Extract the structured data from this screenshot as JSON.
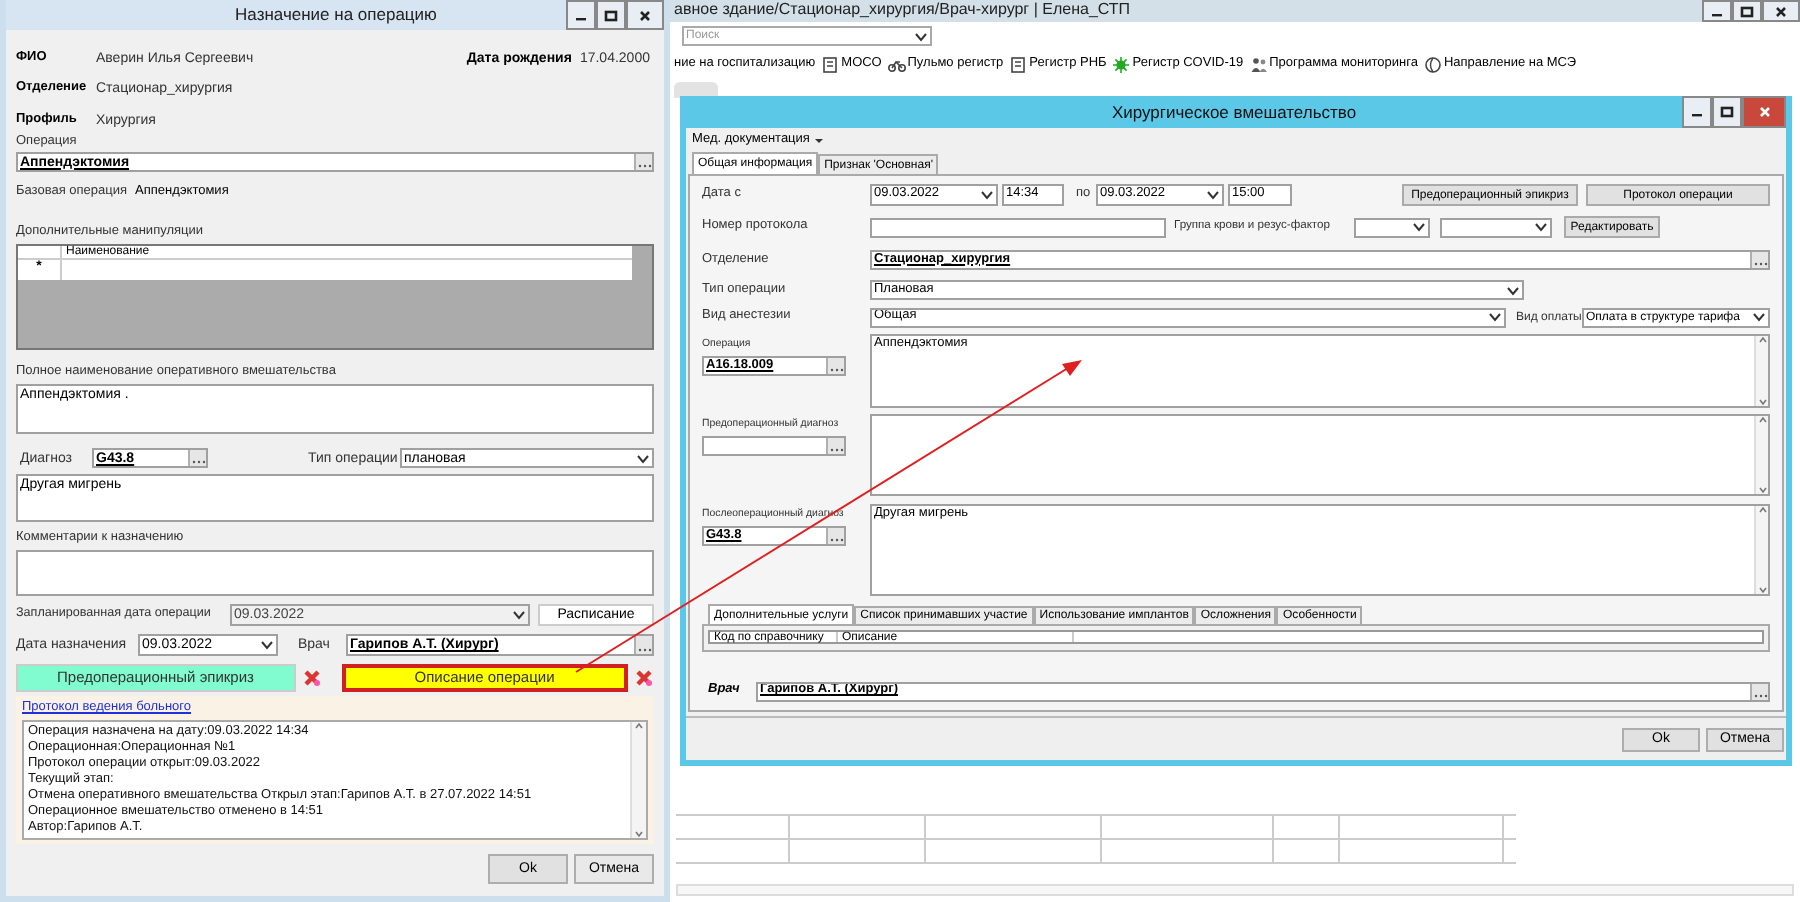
{
  "background_window": {
    "title": "авное здание/Стационар_хирургия/Врач-хирург | Елена_СТП",
    "search": {
      "placeholder": "Поиск"
    },
    "toolbar": [
      {
        "label": "ние на госпитализацию",
        "kind": "plain"
      },
      {
        "label": "МОСО",
        "kind": "document"
      },
      {
        "label": "Пульмо регистр",
        "kind": "bike"
      },
      {
        "label": "Регистр РНБ",
        "kind": "document"
      },
      {
        "label": "Регистр COVID-19",
        "kind": "virus"
      },
      {
        "label": "Программа мониторинга",
        "kind": "people"
      },
      {
        "label": "Направление на МСЭ",
        "kind": "globe"
      }
    ]
  },
  "assignment_dialog": {
    "title": "Назначение на операцию",
    "fio_label": "ФИО",
    "fio": "Аверин Илья Сергеевич",
    "birth_label": "Дата рождения",
    "birth_date": "17.04.2000",
    "department_label": "Отделение",
    "department": "Стационар_хирургия",
    "profile_label": "Профиль",
    "profile": "Хирургия",
    "operation_label": "Операция",
    "operation": "Аппендэктомия",
    "base_operation_label": "Базовая операция",
    "base_operation": "Аппендэктомия",
    "manipulations": {
      "label": "Дополнительные манипуляции",
      "column": "Наименование",
      "new_row_marker": "*"
    },
    "full_name": {
      "label": "Полное наименование оперативного вмешательства",
      "value": "Аппендэктомия ."
    },
    "diagnosis": {
      "label": "Диагноз",
      "code": "G43.8",
      "text": "Другая мигрень"
    },
    "operation_type": {
      "label": "Тип операции",
      "value": "плановая"
    },
    "comment_label": "Комментарии к назначению",
    "planned_date": {
      "label": "Запланированная дата операции",
      "value": "09.03.2022",
      "disabled": true
    },
    "schedule_button": "Расписание",
    "assign_date": {
      "label": "Дата назначения",
      "value": "09.03.2022"
    },
    "doctor": {
      "label": "Врач",
      "value": "Гарипов А.Т. (Хирург)"
    },
    "action_buttons": [
      {
        "label": "Предоперационный эпикриз",
        "color": "#80fcd0",
        "focused": false
      },
      {
        "label": "Описание операции",
        "color": "#ffff00",
        "focused": true
      }
    ],
    "protocol_link": "Протокол ведения больного",
    "log": [
      "Операция назначена на дату:09.03.2022 14:34",
      "Операционная:Операционная №1",
      "Протокол операции открыт:09.03.2022",
      "Текущий этап:",
      "Отмена оперативного вмешательства Открыл этап:Гарипов А.Т. в 27.07.2022 14:51",
      "Операционное вмешательство отменено в 14:51",
      "Автор:Гарипов А.Т."
    ],
    "buttons": [
      "Ok",
      "Отмена"
    ]
  },
  "surgery_dialog": {
    "title": "Хирургическое вмешательство",
    "menu": "Мед. документация",
    "tabs": [
      {
        "label": "Общая информация",
        "selected": true
      },
      {
        "label": "Признак 'Основная'",
        "selected": false
      }
    ],
    "date_from_label": "Дата с",
    "date_from": "09.03.2022",
    "time_from": "14:34",
    "to_label": "по",
    "date_to": "09.03.2022",
    "time_to": "15:00",
    "top_buttons": [
      "Предоперационный эпикриз",
      "Протокол операции"
    ],
    "protocol_label": "Номер протокола",
    "blood_label": "Группа крови и резус-фактор",
    "edit_button": "Редактировать",
    "department_label": "Отделение",
    "department": "Стационар_хирургия",
    "operation_type_label": "Тип операции",
    "operation_type": "Плановая",
    "anesthesia_label": "Вид анестезии",
    "anesthesia": "Общая",
    "payment_label": "Вид оплаты",
    "payment": "Оплата в структуре тарифа",
    "blocks": [
      {
        "label": "Операция",
        "code": "A16.18.009",
        "text": "Аппендэктомия"
      },
      {
        "label": "Предоперационный диагноз"
      },
      {
        "label": "Послеоперационный диагноз",
        "code": "G43.8",
        "text": "Другая мигрень"
      }
    ],
    "bottom_tabs": [
      {
        "label": "Дополнительные услуги",
        "selected": true
      },
      {
        "label": "Список принимавших участие",
        "selected": false
      },
      {
        "label": "Использование имплантов",
        "selected": false
      },
      {
        "label": "Осложнения",
        "selected": false
      },
      {
        "label": "Особенности",
        "selected": false
      }
    ],
    "columns": [
      "Код по справочнику",
      "Описание"
    ],
    "doctor_label": "Врач",
    "doctor": "Гарипов А.Т. (Хирург)",
    "buttons": [
      "Ok",
      "Отмена"
    ]
  }
}
